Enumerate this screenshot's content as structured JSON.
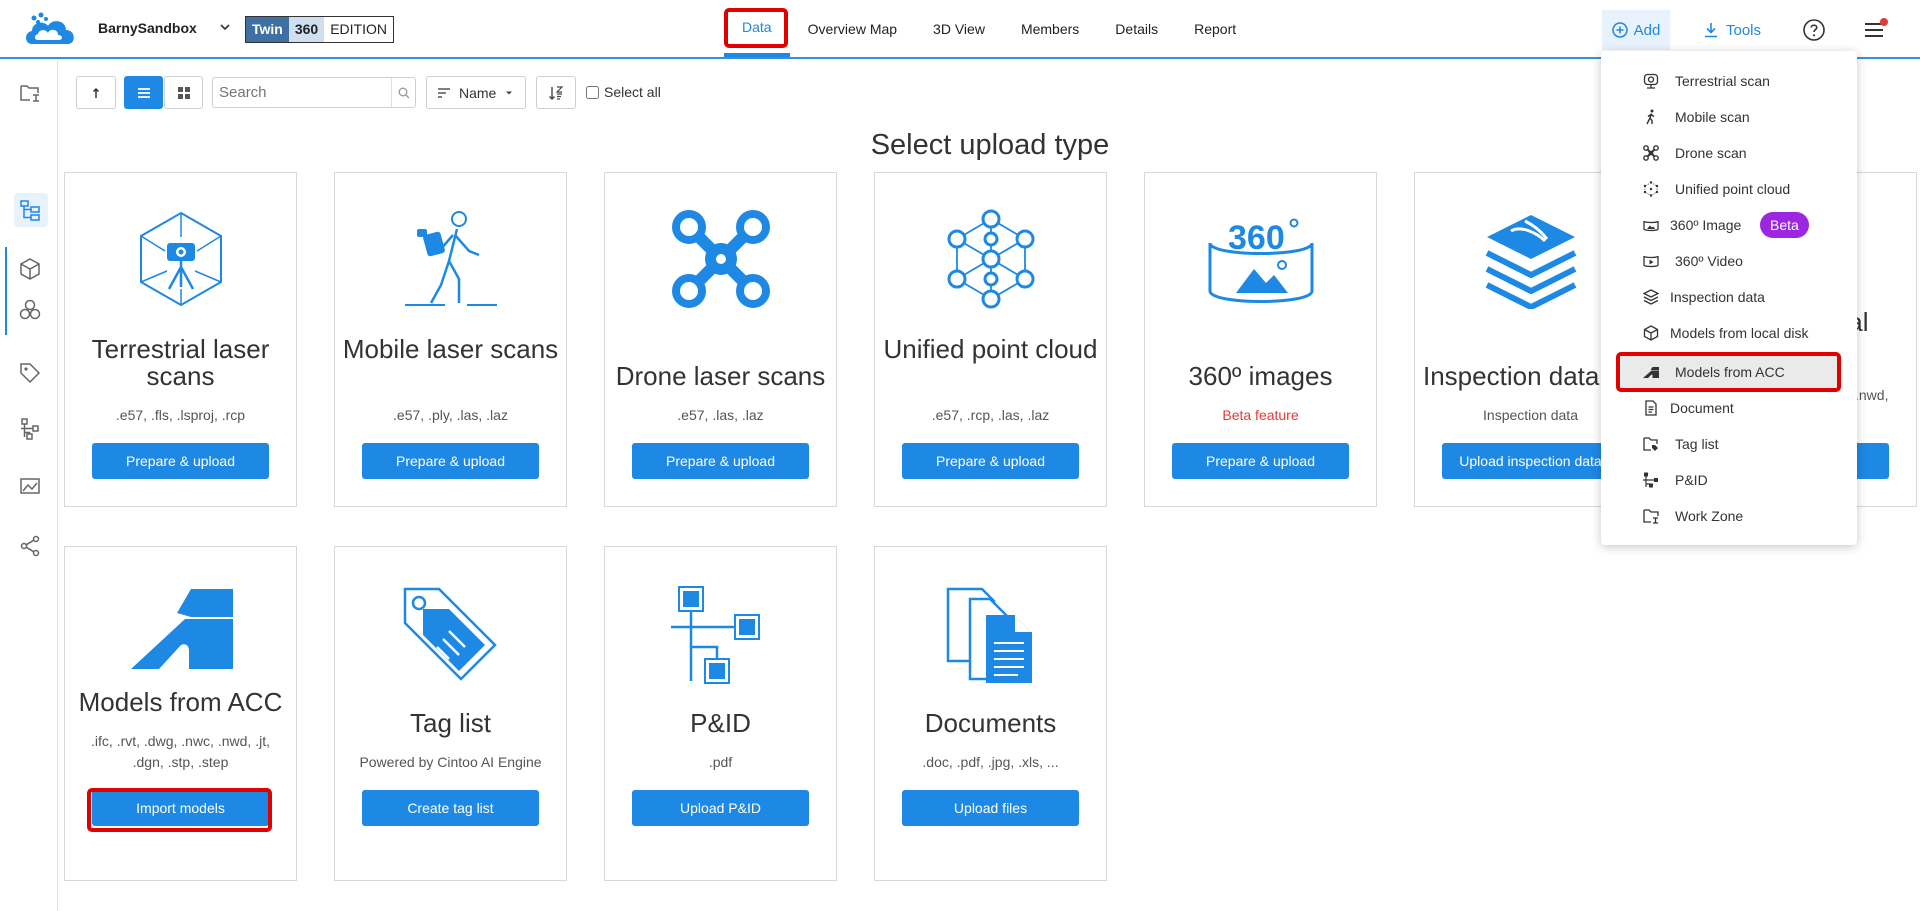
{
  "header": {
    "project_name": "BarnySandbox",
    "edition": {
      "twin": "Twin",
      "num": "360",
      "label": "EDITION"
    },
    "tabs": [
      {
        "label": "Data",
        "active": true
      },
      {
        "label": "Overview Map"
      },
      {
        "label": "3D View"
      },
      {
        "label": "Members"
      },
      {
        "label": "Details"
      },
      {
        "label": "Report"
      }
    ],
    "add_label": "Add",
    "tools_label": "Tools"
  },
  "toolbar": {
    "search_placeholder": "Search",
    "sort_label": "Name",
    "select_all_label": "Select all"
  },
  "heading": "Select upload type",
  "cards": [
    {
      "title": "Terrestrial laser scans",
      "subtitle": ".e57, .fls, .lsproj, .rcp",
      "button": "Prepare & upload"
    },
    {
      "title": "Mobile laser scans",
      "subtitle": ".e57, .ply, .las, .laz",
      "button": "Prepare & upload"
    },
    {
      "title": "Drone laser scans",
      "subtitle": ".e57, .las, .laz",
      "button": "Prepare & upload"
    },
    {
      "title": "Unified point cloud",
      "subtitle": ".e57, .rcp, .las, .laz",
      "button": "Prepare & upload"
    },
    {
      "title": "360º images",
      "subtitle": "Beta feature",
      "button": "Prepare & upload"
    },
    {
      "title": "Inspection data",
      "subtitle": "Inspection data",
      "button": "Upload inspection data"
    },
    {
      "title": "local",
      "subtitle": ".nwd,",
      "button": ""
    },
    {
      "title": "Models from ACC",
      "subtitle": ".ifc, .rvt, .dwg, .nwc, .nwd, .jt, .dgn, .stp, .step",
      "button": "Import models"
    },
    {
      "title": "Tag list",
      "subtitle": "Powered by Cintoo AI Engine",
      "button": "Create tag list"
    },
    {
      "title": "P&ID",
      "subtitle": ".pdf",
      "button": "Upload P&ID"
    },
    {
      "title": "Documents",
      "subtitle": ".doc, .pdf, .jpg, .xls, ...",
      "button": "Upload files"
    }
  ],
  "dropdown": {
    "items": [
      {
        "label": "Terrestrial scan",
        "icon": "terrestrial-scan-icon"
      },
      {
        "label": "Mobile scan",
        "icon": "mobile-scan-icon"
      },
      {
        "label": "Drone scan",
        "icon": "drone-scan-icon"
      },
      {
        "label": "Unified point cloud",
        "icon": "unified-point-cloud-icon"
      },
      {
        "label": "360º Image",
        "icon": "image-360-icon",
        "badge": "Beta"
      },
      {
        "label": "360º Video",
        "icon": "video-360-icon"
      },
      {
        "label": "Inspection data",
        "icon": "inspection-data-icon"
      },
      {
        "label": "Models from local disk",
        "icon": "model-local-icon"
      },
      {
        "label": "Models from ACC",
        "icon": "acc-icon",
        "selected": true
      },
      {
        "label": "Document",
        "icon": "document-icon"
      },
      {
        "label": "Tag list",
        "icon": "tag-list-icon"
      },
      {
        "label": "P&ID",
        "icon": "pid-icon"
      },
      {
        "label": "Work Zone",
        "icon": "work-zone-icon"
      }
    ]
  },
  "colors": {
    "primary": "#1e88e5",
    "highlight": "#e10000",
    "beta": "#9c27e0",
    "warning_text": "#e53935"
  }
}
